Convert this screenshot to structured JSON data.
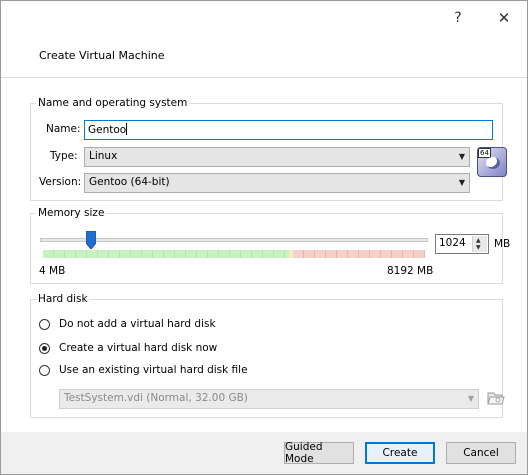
{
  "window": {
    "title": "Create Virtual Machine",
    "help_glyph": "?",
    "close_glyph": "✕"
  },
  "name_os": {
    "legend": "Name and operating system",
    "name_label": "Name:",
    "name_value": "Gentoo",
    "type_label": "Type:",
    "type_value": "Linux",
    "version_label": "Version:",
    "version_value": "Gentoo (64-bit)",
    "os_icon": "gentoo-64-icon",
    "os_badge": "64"
  },
  "memory": {
    "legend": "Memory size",
    "value": "1024",
    "unit": "MB",
    "min_label": "4 MB",
    "max_label": "8192 MB",
    "slider_fraction": 0.125
  },
  "hard_disk": {
    "legend": "Hard disk",
    "options": [
      {
        "label": "Do not add a virtual hard disk",
        "checked": false
      },
      {
        "label": "Create a virtual hard disk now",
        "checked": true
      },
      {
        "label": "Use an existing virtual hard disk file",
        "checked": false
      }
    ],
    "existing_file": "TestSystem.vdi (Normal, 32.00 GB)"
  },
  "buttons": {
    "guided": "Guided Mode",
    "create": "Create",
    "cancel": "Cancel"
  },
  "colors": {
    "accent": "#0078d7",
    "slider_green": "#c9f2c4",
    "slider_red": "#f6cfc9"
  }
}
